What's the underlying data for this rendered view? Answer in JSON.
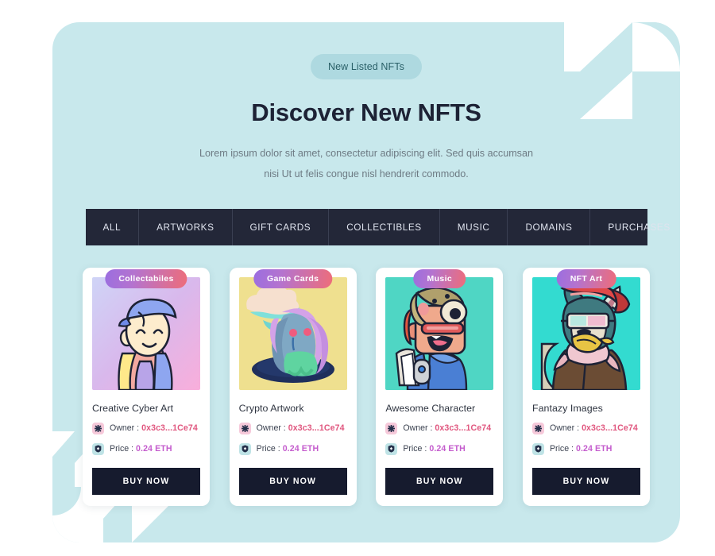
{
  "theme": {
    "page_bg": "#ffffff",
    "panel_bg": "#c8e8ec",
    "deco_color": "#ffffff",
    "tabbar_bg": "#232738",
    "card_bg": "#ffffff",
    "badge_gradient_from": "#9b6ee0",
    "badge_gradient_to": "#ee6d79",
    "buy_button_bg": "#161b2e",
    "owner_value_color": "#e0577f",
    "price_value_color": "#c45ccd",
    "eyebrow_pill_bg": "#aed9e0",
    "eyebrow_pill_text": "#2a6068",
    "title_color": "#1d2235",
    "subtitle_color": "#6d7a83"
  },
  "header": {
    "eyebrow": "New Listed NFTs",
    "title": "Discover New NFTS",
    "subtitle": "Lorem ipsum dolor sit amet, consectetur adipiscing elit. Sed quis accumsan nisi Ut ut felis congue nisl hendrerit commodo."
  },
  "tabs": [
    {
      "label": "ALL"
    },
    {
      "label": "ARTWORKS"
    },
    {
      "label": "GIFT CARDS"
    },
    {
      "label": "COLLECTIBLES"
    },
    {
      "label": "MUSIC"
    },
    {
      "label": "DOMAINS"
    },
    {
      "label": "PURCHASES"
    }
  ],
  "labels": {
    "owner": "Owner :",
    "price": "Price :",
    "buy": "BUY NOW",
    "owner_icon": "asterisk-icon",
    "price_icon": "shield-icon"
  },
  "cards": [
    {
      "badge": "Collectabiles",
      "title": "Creative Cyber Art",
      "owner": "0x3c3...1Ce74",
      "price": "0.24 ETH",
      "buy": "BUY NOW",
      "art": "boy-with-cap"
    },
    {
      "badge": "Game Cards",
      "title": "Crypto Artwork",
      "owner": "0x3c3...1Ce74",
      "price": "0.24 ETH",
      "buy": "BUY NOW",
      "art": "melting-head"
    },
    {
      "badge": "Music",
      "title": "Awesome Character",
      "owner": "0x3c3...1Ce74",
      "price": "0.24 ETH",
      "buy": "BUY NOW",
      "art": "robot-character"
    },
    {
      "badge": "NFT Art",
      "title": "Fantazy Images",
      "owner": "0x3c3...1Ce74",
      "price": "0.24 ETH",
      "buy": "BUY NOW",
      "art": "husky-with-cap"
    }
  ]
}
